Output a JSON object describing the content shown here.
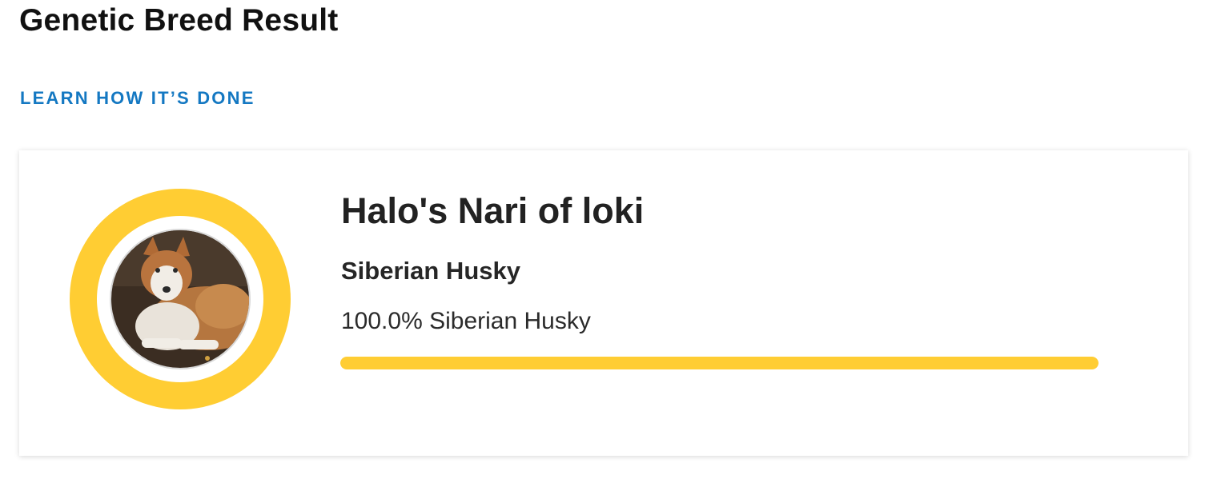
{
  "page": {
    "title": "Genetic Breed Result",
    "learn_link": "LEARN HOW IT’S DONE"
  },
  "result": {
    "dog_name": "Halo's Nari of loki",
    "breed": "Siberian Husky",
    "composition": [
      {
        "percent_label": "100.0%",
        "breed": "Siberian Husky",
        "fraction": 1.0
      }
    ]
  },
  "colors": {
    "accent": "#ffcd33",
    "link": "#1478c2",
    "text": "#1a1a1a"
  },
  "icons": {
    "avatar": "dog-photo"
  }
}
